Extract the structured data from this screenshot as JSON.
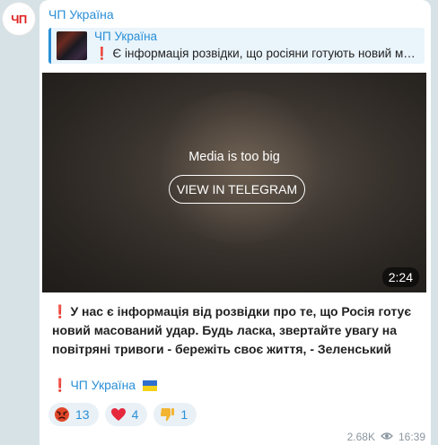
{
  "avatar": {
    "text": "ЧП"
  },
  "post": {
    "channel_name": "ЧП Україна",
    "reply": {
      "title": "ЧП Україна",
      "text": "❗ Є інформація розвідки, що росіяни готують новий масований удар…"
    },
    "media": {
      "notice": "Media is too big",
      "button_label": "VIEW IN TELEGRAM",
      "duration": "2:24"
    },
    "text": "У нас є інформація від розвідки про те, що Росія готує новий масований удар. Будь ласка, звертайте увагу на повітряні тривоги - бережіть своє життя, - Зеленський",
    "signature": "ЧП Україна",
    "reactions": [
      {
        "emoji": "angry-face-icon",
        "count": "13"
      },
      {
        "emoji": "red-heart-icon",
        "count": "4"
      },
      {
        "emoji": "thumbs-down-icon",
        "count": "1"
      }
    ],
    "views": "2.68K",
    "time": "16:39"
  },
  "colors": {
    "accent": "#2a8fd6",
    "background": "#d7e2e6",
    "alert_red": "#e02020"
  }
}
